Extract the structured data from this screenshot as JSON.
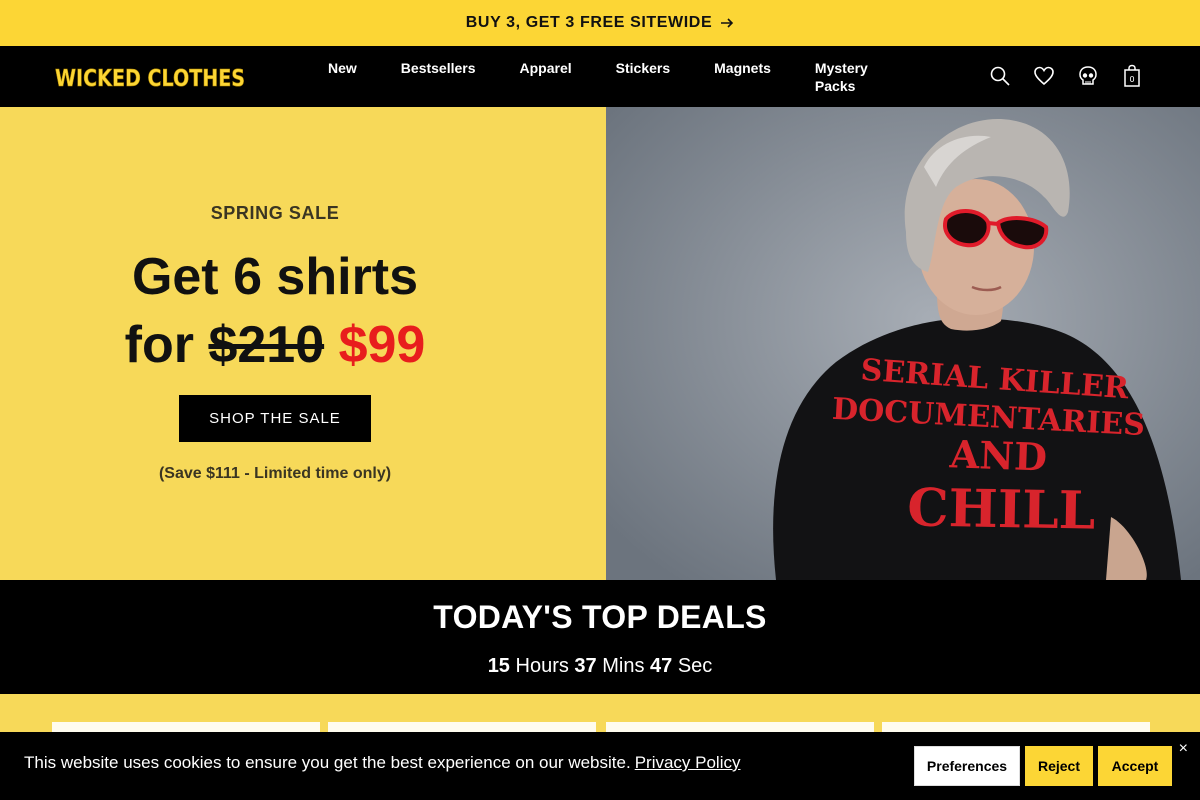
{
  "announcement": {
    "text": "BUY 3, GET 3 FREE SITEWIDE",
    "icon": "arrow-right-icon"
  },
  "brand": {
    "logo_text": "WICKED CLOTHES",
    "accent": "#fcd635"
  },
  "nav": {
    "items": [
      "New",
      "Bestsellers",
      "Apparel",
      "Stickers",
      "Magnets"
    ],
    "mystery_line1": "Mystery",
    "mystery_line2": "Packs"
  },
  "header_icons": {
    "icons": [
      "search-icon",
      "heart-icon",
      "skull-account-icon",
      "shopping-bag-icon"
    ],
    "cart_count": "0"
  },
  "hero": {
    "eyebrow": "SPRING SALE",
    "headline_line1": "Get 6 shirts",
    "headline_for": "for",
    "old_price": "$210",
    "new_price": "$99",
    "cta": "SHOP THE SALE",
    "note": "(Save $111 - Limited time only)",
    "image_shirt_text": [
      "SERIAL KILLER",
      "DOCUMENTARIES",
      "AND",
      "CHILL"
    ]
  },
  "deals": {
    "title": "TODAY'S TOP DEALS",
    "hours": "15",
    "hours_label": "Hours",
    "mins": "37",
    "mins_label": "Mins",
    "secs": "47",
    "secs_label": "Sec"
  },
  "cookie": {
    "text": "This website uses cookies to ensure you get the best experience on our website.",
    "link": "Privacy Policy",
    "preferences": "Preferences",
    "reject": "Reject",
    "accept": "Accept",
    "close": "×"
  }
}
